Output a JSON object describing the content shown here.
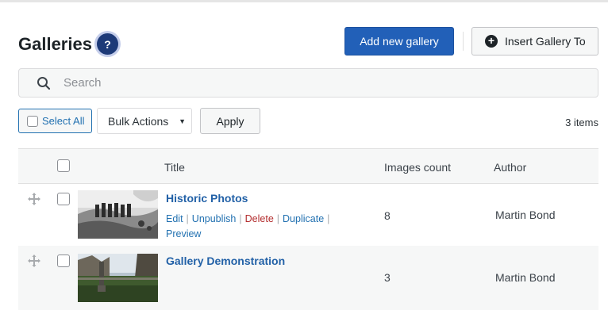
{
  "header": {
    "title": "Galleries",
    "help_label": "?",
    "add_button": "Add new gallery",
    "insert_button": "Insert Gallery To"
  },
  "search": {
    "placeholder": "Search"
  },
  "toolbar": {
    "select_all": "Select All",
    "bulk_actions": "Bulk Actions",
    "apply": "Apply",
    "item_count": "3 items"
  },
  "table": {
    "columns": [
      "Title",
      "Images count",
      "Author"
    ],
    "rows": [
      {
        "title": "Historic Photos",
        "images_count": "8",
        "author": "Martin Bond",
        "actions": [
          "Edit",
          "Unpublish",
          "Delete",
          "Duplicate",
          "Preview"
        ]
      },
      {
        "title": "Gallery Demonstration",
        "images_count": "3",
        "author": "Martin Bond"
      }
    ]
  },
  "colors": {
    "primary_button": "#2260b8",
    "link": "#2271b1",
    "delete_link": "#b32d2e",
    "help_badge": "#1d3a78"
  },
  "icons": [
    "help-icon",
    "plus-circle-icon",
    "search-icon",
    "drag-handle-icon"
  ]
}
